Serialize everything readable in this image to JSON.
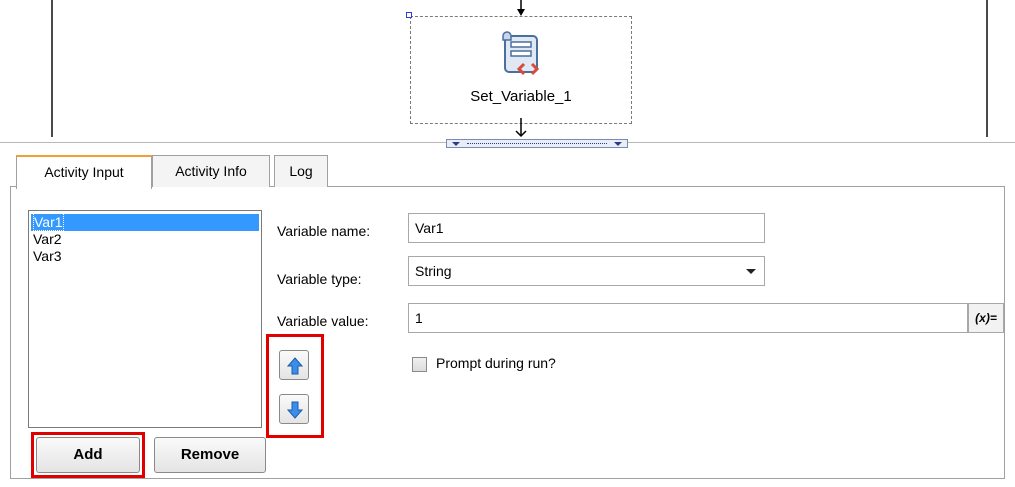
{
  "canvas": {
    "activity_label": "Set_Variable_1"
  },
  "tabs": [
    {
      "label": "Activity Input",
      "active": true
    },
    {
      "label": "Activity Info",
      "active": false
    },
    {
      "label": "Log",
      "active": false
    }
  ],
  "variables": [
    "Var1",
    "Var2",
    "Var3"
  ],
  "buttons": {
    "add": "Add",
    "remove": "Remove"
  },
  "form": {
    "name_label": "Variable name:",
    "name_value": "Var1",
    "type_label": "Variable type:",
    "type_value": "String",
    "value_label": "Variable value:",
    "value_value": "1",
    "expr_button": "(x)=",
    "prompt_label": "Prompt during run?",
    "prompt_checked": false
  },
  "icons": {
    "activity": "set-variable-icon",
    "move_up": "arrow-up-icon",
    "move_down": "arrow-down-icon"
  },
  "colors": {
    "highlight": "#e00000",
    "selection": "#3399ff",
    "active_tab_accent": "#f0a030"
  }
}
